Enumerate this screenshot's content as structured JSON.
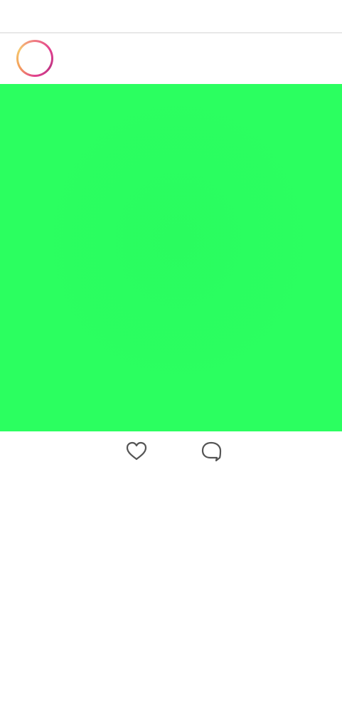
{
  "post": {
    "media": {
      "color": "#2bff60"
    },
    "avatar": {
      "icon": "avatar-ring-icon",
      "ring_colors": [
        "#f5c66f",
        "#e2408f",
        "#c13584"
      ]
    },
    "actions": [
      {
        "icon": "heart-outline-icon"
      },
      {
        "icon": "comment-bubble-icon"
      }
    ]
  },
  "colors": {
    "background": "#ffffff",
    "divider": "#e8e8e8",
    "icon_stroke": "#555555"
  }
}
